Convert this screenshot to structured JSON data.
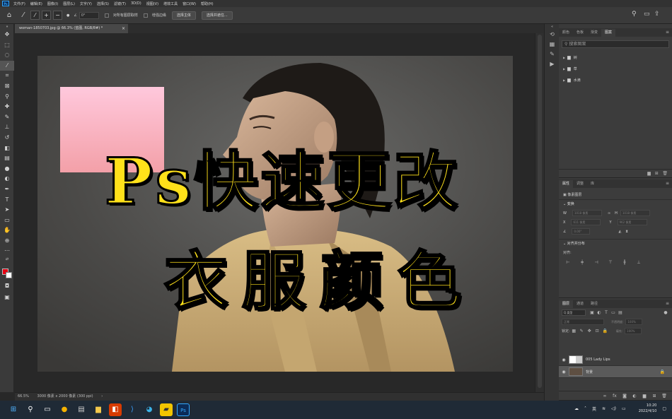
{
  "menubar": {
    "items": [
      "文件(F)",
      "编辑(E)",
      "图像(I)",
      "图层(L)",
      "文字(Y)",
      "选择(S)",
      "滤镜(T)",
      "3D(D)",
      "视图(V)",
      "增效工具",
      "窗口(W)",
      "帮助(H)"
    ]
  },
  "options": {
    "angle": "0°",
    "sample_all_layers": "对所有图层取样",
    "enhance_edge": "增强边缘",
    "select_subject": "选择主体",
    "select_and_mask": "选择并遮住..."
  },
  "document": {
    "tab_title": "woman-1850703.jpg @ 66.3% (蓝图, RGB/8#) *",
    "tab_close": "×"
  },
  "headline": {
    "line1": "Ps快速更改",
    "line2": "衣服颜色"
  },
  "statusbar": {
    "zoom": "66.5%",
    "info": "3000 像素 x 2000 像素 (300 ppi)"
  },
  "libraries": {
    "tabs": [
      "颜色",
      "色板",
      "渐变",
      "图案"
    ],
    "active_tab": 3,
    "search_placeholder": "搜索图案",
    "folders": [
      "树",
      "草",
      "水滴"
    ]
  },
  "properties": {
    "tabs": [
      "属性",
      "调整",
      "库"
    ],
    "layer_label": "像素图层",
    "transform_label": "变换",
    "w_label": "W",
    "w_value": "1018 像素",
    "h_label": "H",
    "h_value": "1018 像素",
    "x_label": "X",
    "x_value": "611 像素",
    "y_label": "Y",
    "y_value": "962 像素",
    "angle_value": "0.00°",
    "align_label": "对齐并分布",
    "align_sub": "对齐:"
  },
  "layers": {
    "tabs": [
      "图层",
      "通道",
      "路径"
    ],
    "kind_filter": "Q 类型",
    "blend_mode": "正常",
    "opacity_label": "不透明度:",
    "opacity_value": "100%",
    "lock_label": "锁定:",
    "fill_label": "填充:",
    "fill_value": "100%",
    "items": [
      {
        "name": "005 Lady Lips",
        "selected": false
      },
      {
        "name": "背景",
        "selected": true
      }
    ]
  },
  "taskbar": {
    "lang": "英",
    "time": "10:20",
    "date": "2022/4/10"
  },
  "colors": {
    "foreground": "#e60012",
    "background": "#ffffff",
    "headline_fill": "#ffe11a"
  }
}
